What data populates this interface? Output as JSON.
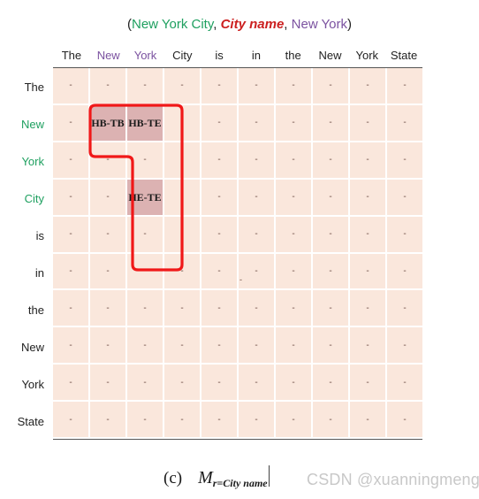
{
  "title": {
    "tokens": [
      {
        "text": "(",
        "style": "plain"
      },
      {
        "text": "New York City",
        "style": "green"
      },
      {
        "text": ", ",
        "style": "plain"
      },
      {
        "text": "City name",
        "style": "red"
      },
      {
        "text": ", ",
        "style": "plain"
      },
      {
        "text": "New York",
        "style": "purple"
      },
      {
        "text": ")",
        "style": "plain"
      }
    ]
  },
  "colors": {
    "subject_green": "#1fa060",
    "relation_red": "#cc2020",
    "object_purple": "#7b52a0",
    "cell_background": "#fae7dc",
    "cell_highlight": "#dcb2b2",
    "selection_outline": "#f01818",
    "grid_line": "#ffffff",
    "watermark": "#c8c8c8"
  },
  "matrix": {
    "column_headers": [
      {
        "label": "The",
        "highlight": "none"
      },
      {
        "label": "New",
        "highlight": "purple"
      },
      {
        "label": "York",
        "highlight": "purple"
      },
      {
        "label": "City",
        "highlight": "none"
      },
      {
        "label": "is",
        "highlight": "none"
      },
      {
        "label": "in",
        "highlight": "none"
      },
      {
        "label": "the",
        "highlight": "none"
      },
      {
        "label": "New",
        "highlight": "none"
      },
      {
        "label": "York",
        "highlight": "none"
      },
      {
        "label": "State",
        "highlight": "none"
      }
    ],
    "row_headers": [
      {
        "label": "The",
        "highlight": "none"
      },
      {
        "label": "New",
        "highlight": "green"
      },
      {
        "label": "York",
        "highlight": "green"
      },
      {
        "label": "City",
        "highlight": "green"
      },
      {
        "label": "is",
        "highlight": "none"
      },
      {
        "label": "in",
        "highlight": "none"
      },
      {
        "label": "the",
        "highlight": "none"
      },
      {
        "label": "New",
        "highlight": "none"
      },
      {
        "label": "York",
        "highlight": "none"
      },
      {
        "label": "State",
        "highlight": "none"
      }
    ],
    "empty_value": "-",
    "rows": [
      [
        "-",
        "-",
        "-",
        "-",
        "-",
        "-",
        "-",
        "-",
        "-",
        "-"
      ],
      [
        "-",
        "HB-TB",
        "HB-TE",
        "-",
        "-",
        "-",
        "-",
        "-",
        "-",
        "-"
      ],
      [
        "-",
        "-",
        "-",
        "-",
        "-",
        "-",
        "-",
        "-",
        "-",
        "-"
      ],
      [
        "-",
        "-",
        "HE-TE",
        "-",
        "-",
        "-",
        "-",
        "-",
        "-",
        "-"
      ],
      [
        "-",
        "-",
        "-",
        "-",
        "-",
        "-",
        "-",
        "-",
        "-",
        "-"
      ],
      [
        "-",
        "-",
        "-",
        "-",
        "-",
        "-",
        "-",
        "-",
        "-",
        "-"
      ],
      [
        "-",
        "-",
        "-",
        "-",
        "-",
        "-",
        "-",
        "-",
        "-",
        "-"
      ],
      [
        "-",
        "-",
        "-",
        "-",
        "-",
        "-",
        "-",
        "-",
        "-",
        "-"
      ],
      [
        "-",
        "-",
        "-",
        "-",
        "-",
        "-",
        "-",
        "-",
        "-",
        "-"
      ],
      [
        "-",
        "-",
        "-",
        "-",
        "-",
        "-",
        "-",
        "-",
        "-",
        "-"
      ]
    ],
    "filled_cells": [
      {
        "row": 1,
        "col": 1,
        "value": "HB-TB"
      },
      {
        "row": 1,
        "col": 2,
        "value": "HB-TE"
      },
      {
        "row": 3,
        "col": 2,
        "value": "HE-TE"
      }
    ],
    "stray_dash": "-"
  },
  "caption": {
    "label": "(c)",
    "symbol": "M",
    "subscript": "r=City name"
  },
  "watermark": {
    "text": "CSDN @xuanningmeng"
  }
}
